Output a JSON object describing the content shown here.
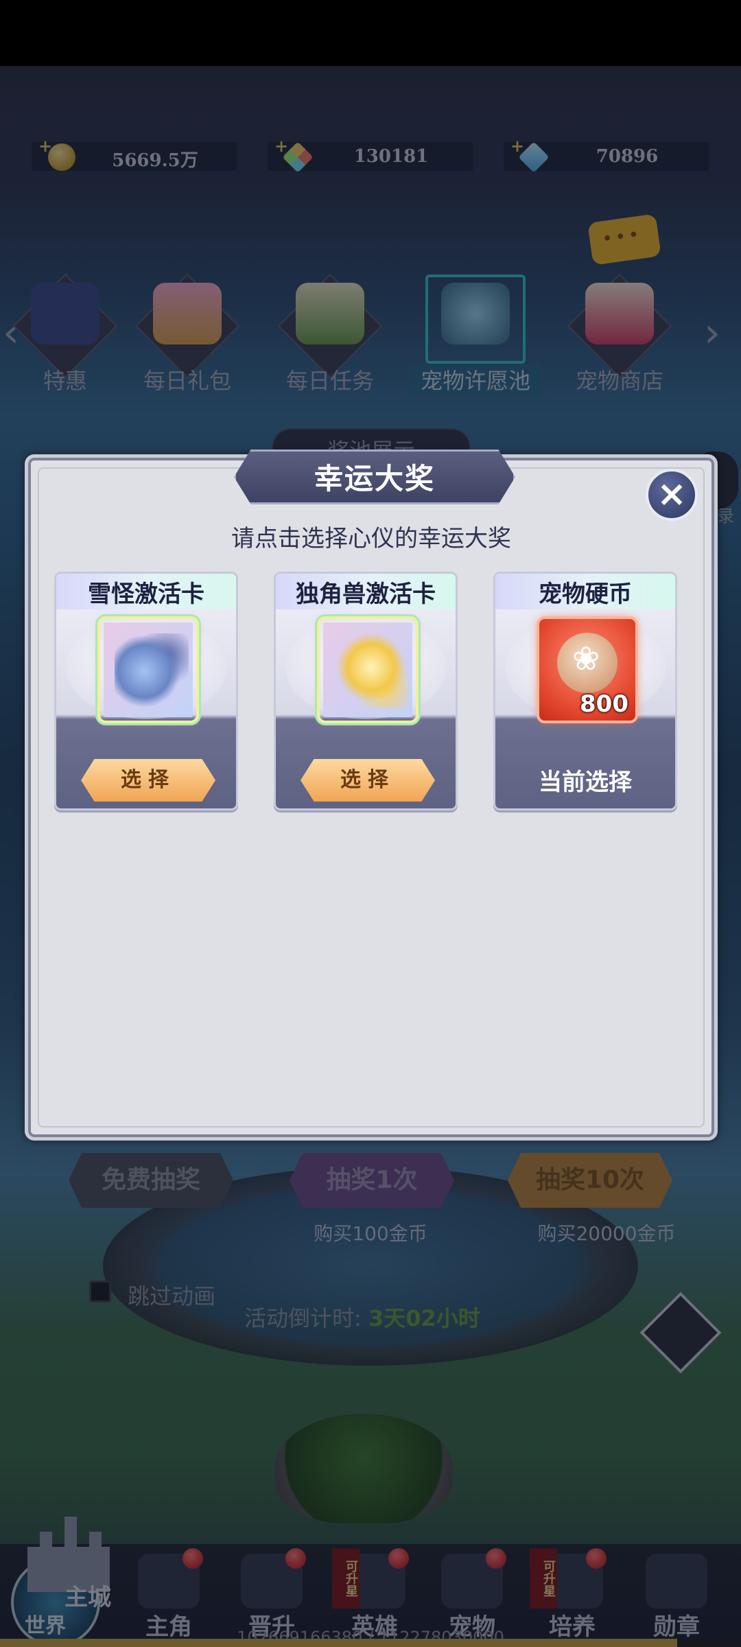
{
  "currencies": [
    {
      "icon": "gold-coin-icon",
      "value": "5669.5万"
    },
    {
      "icon": "rainbow-gem-icon",
      "value": "130181"
    },
    {
      "icon": "blue-diamond-icon",
      "value": "70896"
    }
  ],
  "chat_bubble": "•••",
  "top_nav": {
    "items": [
      {
        "label": "特惠"
      },
      {
        "label": "每日礼包"
      },
      {
        "label": "每日任务"
      },
      {
        "label": "宠物许愿池",
        "active": true
      },
      {
        "label": "宠物商店"
      }
    ]
  },
  "pool_tab": "奖池展示",
  "side_label": "录",
  "dialog": {
    "title": "幸运大奖",
    "subtitle": "请点击选择心仪的幸运大奖",
    "close_icon": "×",
    "cards": [
      {
        "title": "雪怪激活卡",
        "button": "选择",
        "selected": false
      },
      {
        "title": "独角兽激活卡",
        "button": "选择",
        "selected": false
      },
      {
        "title": "宠物硬币",
        "amount": "800",
        "status": "当前选择",
        "selected": true
      }
    ]
  },
  "draw": {
    "free": "免费抽奖",
    "once": "抽奖1次",
    "ten": "抽奖10次",
    "once_price": "购买100金币",
    "ten_price": "购买20000金币"
  },
  "skip_animation": "跳过动画",
  "countdown": {
    "label": "活动倒计时:",
    "value": "3天02小时"
  },
  "bottom_nav": {
    "world_label_top": "主城",
    "world_label_bottom": "世界",
    "items": [
      {
        "label": "主角",
        "dot": true
      },
      {
        "label": "晋升",
        "dot": true
      },
      {
        "label": "英雄",
        "dot": true,
        "tag": "可升星"
      },
      {
        "label": "宠物",
        "dot": true
      },
      {
        "label": "培养",
        "dot": true,
        "tag": "可升星"
      },
      {
        "label": "勋章",
        "dot": false
      }
    ]
  },
  "exp": {
    "text": "102669166380 / 112278030000",
    "progress": 0.914
  }
}
